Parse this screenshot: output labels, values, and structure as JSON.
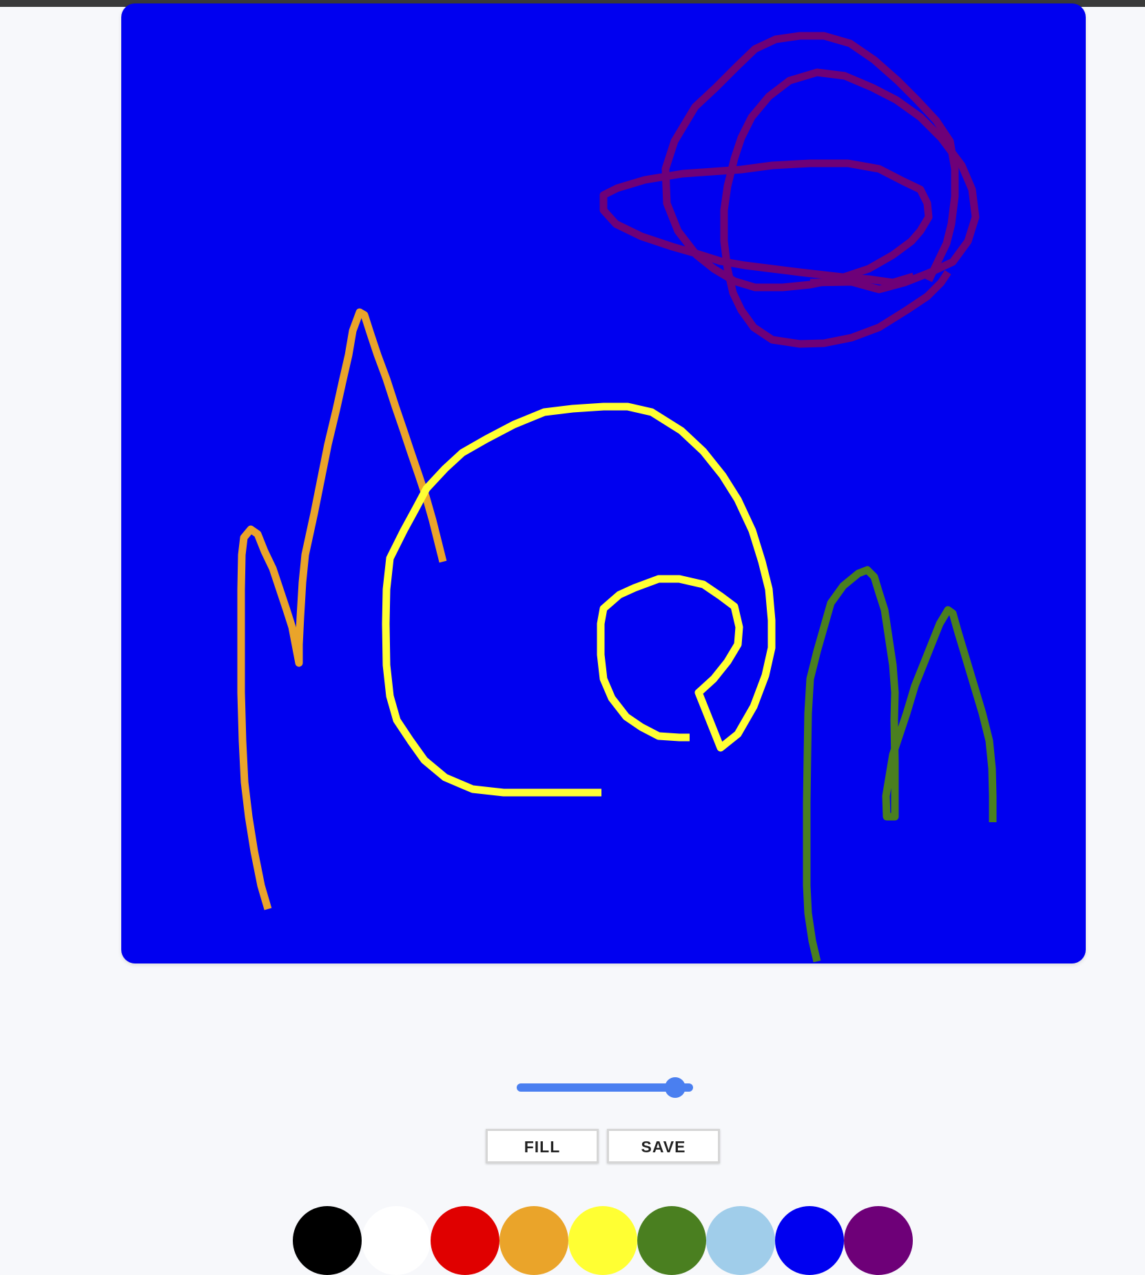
{
  "canvas": {
    "background_color": "#0000f0"
  },
  "brush_size": {
    "value_fraction": 0.95,
    "color": "#4a7ff0"
  },
  "toolbar": {
    "fill_label": "FILL",
    "save_label": "SAVE"
  },
  "palette": [
    {
      "name": "black",
      "color": "#000000"
    },
    {
      "name": "white",
      "color": "#ffffff"
    },
    {
      "name": "red",
      "color": "#e00000"
    },
    {
      "name": "orange",
      "color": "#eaa42a"
    },
    {
      "name": "yellow",
      "color": "#ffff33"
    },
    {
      "name": "green",
      "color": "#4a7f20"
    },
    {
      "name": "light-blue",
      "color": "#a0cdea"
    },
    {
      "name": "blue",
      "color": "#0000f0"
    },
    {
      "name": "purple",
      "color": "#6e0078"
    }
  ],
  "strokes": [
    {
      "name": "orange-stroke",
      "color": "#eaa42a"
    },
    {
      "name": "yellow-spiral-stroke",
      "color": "#ffff33"
    },
    {
      "name": "purple-scribble-stroke",
      "color": "#6e0078"
    },
    {
      "name": "green-stroke",
      "color": "#4a7f20"
    }
  ]
}
